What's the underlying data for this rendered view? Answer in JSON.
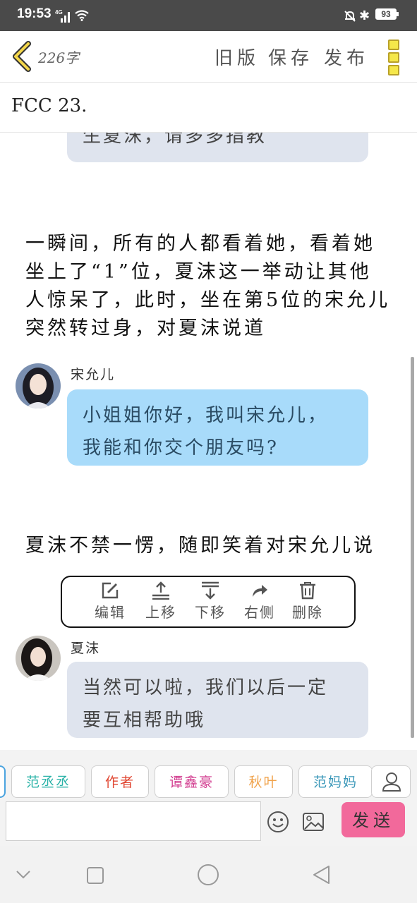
{
  "status_bar": {
    "time": "19:53",
    "network": "4G",
    "battery": "93"
  },
  "header": {
    "word_count": "226字",
    "old_version": "旧版",
    "save": "保存",
    "publish": "发布"
  },
  "title": "FCC 23.",
  "story": {
    "top_bubble_text": "生夏沫，请多多指教",
    "narration_1": "一瞬间，所有的人都看着她，看着她坐上了“1”位，夏沫这一举动让其他人惊呆了，此时，坐在第5位的宋允儿突然转过身，对夏沫说道",
    "message_1": {
      "speaker": "宋允儿",
      "line1": "小姐姐你好，我叫宋允儿，",
      "line2": "我能和你交个朋友吗?"
    },
    "narration_2": "夏沫不禁一愣，随即笑着对宋允儿说",
    "message_2": {
      "speaker": "夏沫",
      "line1": "当然可以啦，我们以后一定",
      "line2": "要互相帮助哦"
    }
  },
  "toolbar": {
    "edit": "编辑",
    "move_up": "上移",
    "move_down": "下移",
    "right_side": "右侧",
    "delete": "删除"
  },
  "characters": [
    {
      "name": "范丞丞",
      "color": "#2bb3a8"
    },
    {
      "name": "作者",
      "color": "#e0442f"
    },
    {
      "name": "谭鑫豪",
      "color": "#d23c8f"
    },
    {
      "name": "秋叶",
      "color": "#f0a24a"
    },
    {
      "name": "范妈妈",
      "color": "#3a97b8"
    }
  ],
  "input": {
    "value": "",
    "send": "发送"
  },
  "colors": {
    "bubble_gray": "#dfe4ee",
    "bubble_blue": "#a8dbfa",
    "send_button": "#f2699b",
    "menu_yellow": "#f5e74a"
  }
}
